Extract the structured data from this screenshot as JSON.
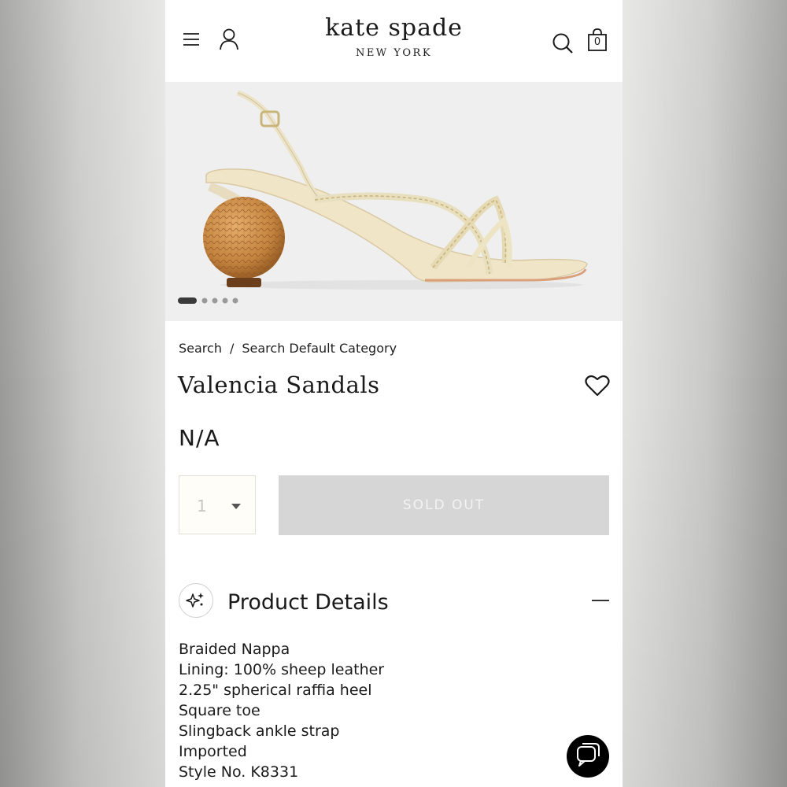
{
  "header": {
    "brand": "kate spade",
    "brand_sub": "NEW YORK",
    "cart_count": "0",
    "icons": [
      "hamburger-menu-icon",
      "account-icon",
      "search-icon",
      "shopping-bag-icon"
    ]
  },
  "gallery": {
    "image_alt": "sandal with spherical raffia heel",
    "total_images": 5,
    "active_index": 1
  },
  "breadcrumb": {
    "items": [
      "Search",
      "Search Default Category"
    ],
    "separator": "/"
  },
  "product": {
    "name": "Valencia Sandals",
    "price": "N/A",
    "quantity": "1",
    "add_button_label": "SOLD OUT"
  },
  "details": {
    "heading": "Product Details",
    "items": [
      "Braided Nappa",
      "Lining: 100% sheep leather",
      "2.25\" spherical raffia heel",
      "Square toe",
      "Slingback ankle strap",
      "Imported",
      "Style No. K8331"
    ]
  },
  "colors": {
    "button_disabled": "#d6d6d6",
    "text": "#1a1a1a",
    "chat_button": "#000000"
  }
}
